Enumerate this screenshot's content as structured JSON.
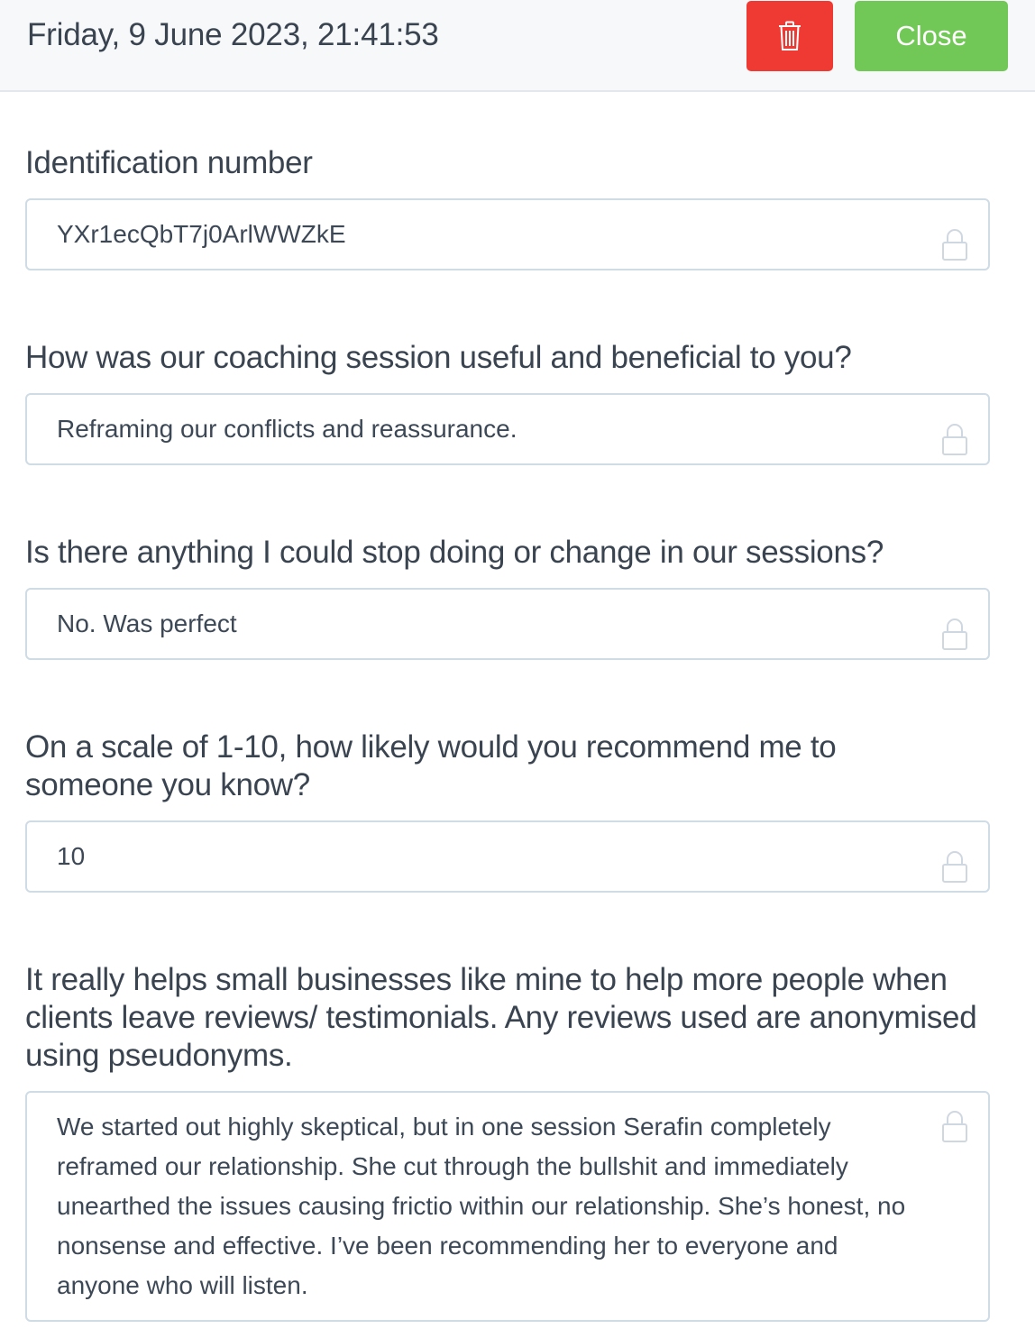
{
  "header": {
    "timestamp": "Friday, 9 June 2023, 21:41:53",
    "delete_icon": "trash-icon",
    "close_label": "Close",
    "colors": {
      "delete": "#ee3a33",
      "close": "#72c857"
    }
  },
  "fields": [
    {
      "label": "Identification number",
      "value": "YXr1ecQbT7j0ArlWWZkE",
      "icon": "lock-icon"
    },
    {
      "label": "How was our coaching session useful and beneficial to you?",
      "value": "Reframing our conflicts and reassurance.",
      "icon": "lock-icon"
    },
    {
      "label": "Is there anything I could stop doing or change in our sessions?",
      "value": "No. Was perfect",
      "icon": "lock-icon"
    },
    {
      "label": "On a scale of 1-10, how likely would you recommend me to someone you know?",
      "value": "10",
      "icon": "lock-icon"
    },
    {
      "label": "It really helps small businesses like mine to help more people when clients leave reviews/ testimonials. Any reviews used are anonymised using pseudonyms.",
      "value": "We started out highly skeptical, but in one session Serafin completely reframed our relationship. She cut through the bullshit and immediately unearthed the issues causing frictio within our relationship. She’s honest, no nonsense and effective. I’ve been recommending her to everyone and anyone who will listen.",
      "icon": "lock-icon"
    }
  ]
}
